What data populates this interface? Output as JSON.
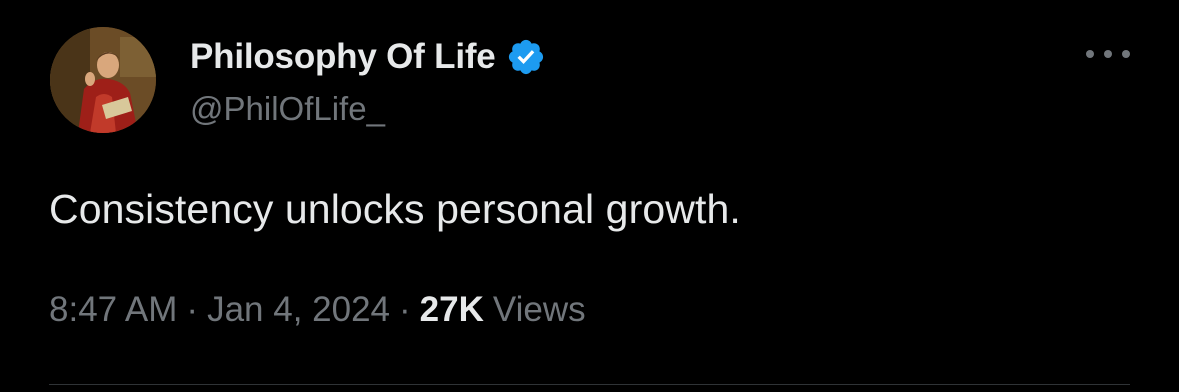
{
  "tweet": {
    "author": {
      "name": "Philosophy Of Life",
      "handle": "@PhilOfLife_",
      "verified": true,
      "avatar_icon": "painting-portrait-avatar"
    },
    "more_icon": "more-horizontal-icon",
    "text": "Consistency unlocks personal growth.",
    "meta": {
      "time": "8:47 AM",
      "separator": "·",
      "date": "Jan 4, 2024",
      "views_count": "27K",
      "views_label": "Views"
    }
  },
  "colors": {
    "background": "#000000",
    "primary_text": "#e7e9ea",
    "secondary_text": "#71767b",
    "verified_badge": "#1d9bf0",
    "divider": "#2f3336"
  }
}
